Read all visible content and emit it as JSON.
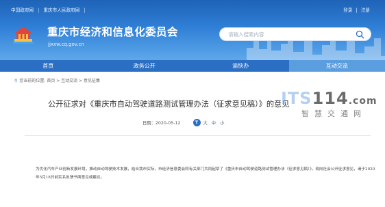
{
  "top_links": [
    "中国政府网",
    "|",
    "重庆市人民政府网",
    "|"
  ],
  "auth": {
    "login": "登录",
    "sep": "|",
    "register": "注册"
  },
  "site": {
    "title": "重庆市经济和信息化委员会",
    "domain": "jjxxw.cq.gov.cn"
  },
  "search": {
    "placeholder": "请输入搜索内容"
  },
  "nav": [
    {
      "label": "首页",
      "active": false
    },
    {
      "label": "政务公开",
      "active": false
    },
    {
      "label": "渝快办",
      "active": false
    },
    {
      "label": "互动交流",
      "active": true
    }
  ],
  "breadcrumb": "您当前的位置:  首页 > 互动交流 > 意见征集",
  "article": {
    "title": "公开征求对《重庆市自动驾驶道路测试管理办法（征求意见稿）》的意见",
    "date": "日期：2020-05-12",
    "font_badge": "T",
    "font_sizes": [
      "大",
      "中",
      "小"
    ],
    "body": "为优化汽车产业创新发展环境，推动自动驾驶技术发展，结合我市实际，市经济信息委会同有关部门共同起草了《重庆市自动驾驶道路测试管理办法（征求意见稿）》，现向社会公开征求意见，请于2020年5月18日前实名反馈书面意见或建议。"
  },
  "watermark": {
    "brand_a": "ITS",
    "brand_b": "114",
    "brand_c": ".com",
    "tagline": "智慧交通网"
  },
  "colors": {
    "nav_bg": "#2a6fc4",
    "nav_active": "#5b9ee0",
    "banner": "#2f7fd6"
  }
}
